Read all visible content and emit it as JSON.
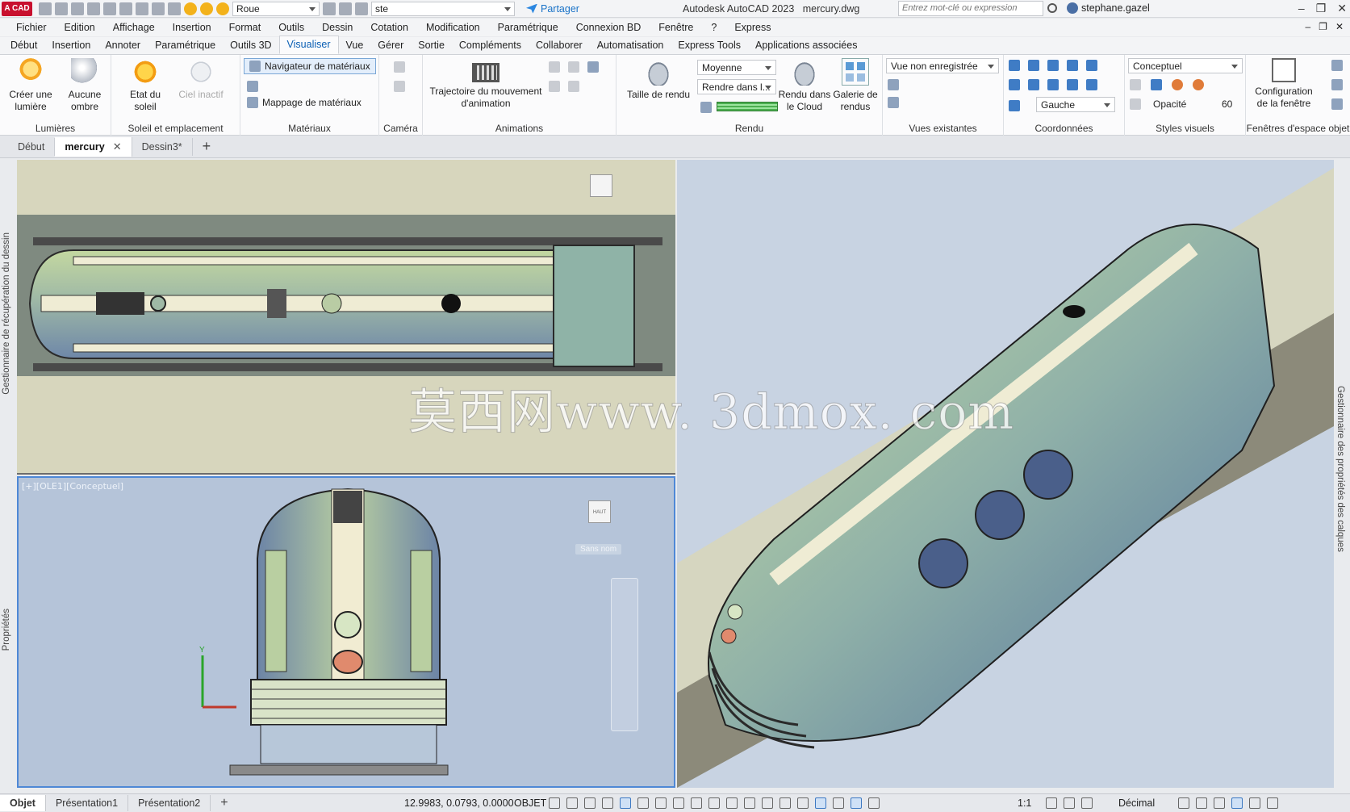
{
  "titlebar": {
    "logo": "A CAD",
    "layer_combo": "Roue",
    "workspace_combo": "ste",
    "share_label": "Partager",
    "app_title": "Autodesk AutoCAD 2023",
    "file_name": "mercury.dwg",
    "search_placeholder": "Entrez mot-clé ou expression",
    "user_name": "stephane.gazel",
    "help": "?"
  },
  "menubar": {
    "items": [
      "Fichier",
      "Edition",
      "Affichage",
      "Insertion",
      "Format",
      "Outils",
      "Dessin",
      "Cotation",
      "Modification",
      "Paramétrique",
      "Connexion BD",
      "Fenêtre",
      "?",
      "Express"
    ]
  },
  "ribbon_tabs": {
    "items": [
      "Début",
      "Insertion",
      "Annoter",
      "Paramétrique",
      "Outils 3D",
      "Visualiser",
      "Vue",
      "Gérer",
      "Sortie",
      "Compléments",
      "Collaborer",
      "Automatisation",
      "Express Tools",
      "Applications associées"
    ],
    "active_index": 5
  },
  "ribbon": {
    "lights": {
      "title": "Lumières",
      "create_light": "Créer une lumière",
      "no_shadow": "Aucune ombre"
    },
    "sun": {
      "title": "Soleil et emplacement",
      "sun_state": "Etat du soleil",
      "sky_off": "Ciel inactif"
    },
    "materials": {
      "title": "Matériaux",
      "browser": "Navigateur de matériaux",
      "mapping": "Mappage de matériaux"
    },
    "camera": {
      "title": "Caméra"
    },
    "animations": {
      "title": "Animations",
      "path": "Trajectoire du mouvement d'animation"
    },
    "render": {
      "title": "Rendu",
      "render_size": "Taille de rendu",
      "quality": "Moyenne",
      "render_in": "Rendre dans l...",
      "cloud": "Rendu dans le Cloud",
      "gallery": "Galerie de rendus"
    },
    "views": {
      "title": "Vues existantes",
      "unsaved_view": "Vue non enregistrée"
    },
    "coordinates": {
      "title": "Coordonnées",
      "ucs_left": "Gauche"
    },
    "visual_styles": {
      "title": "Styles visuels",
      "style": "Conceptuel",
      "opacity_label": "Opacité",
      "opacity_value": "60"
    },
    "model_viewports": {
      "title": "Fenêtres d'espace objet",
      "config": "Configuration de la fenêtre"
    }
  },
  "doc_tabs": {
    "items": [
      "Début",
      "mercury",
      "Dessin3*"
    ],
    "active_index": 1
  },
  "side_palettes": {
    "left_top": "Gestionnaire de récupération du dessin",
    "left_bottom": "Propriétés",
    "right": "Gestionnaire des propriétés des calques"
  },
  "viewports": {
    "front_label": "[+][OLE1][Conceptuel]",
    "front_viewcube": "HAUT",
    "wcs_name": "Sans nom",
    "watermark": "莫西网www. 3dmox. com"
  },
  "statusbar": {
    "layout_tabs": [
      "Objet",
      "Présentation1",
      "Présentation2"
    ],
    "active_layout": 0,
    "coordinates": "12.9983, 0.0793, 0.0000",
    "mode": "OBJET",
    "scale": "1:1",
    "units": "Décimal"
  },
  "colors": {
    "accent": "#0a5fb4",
    "logo_red": "#c8102e",
    "active_viewport_border": "#4e88d6"
  }
}
